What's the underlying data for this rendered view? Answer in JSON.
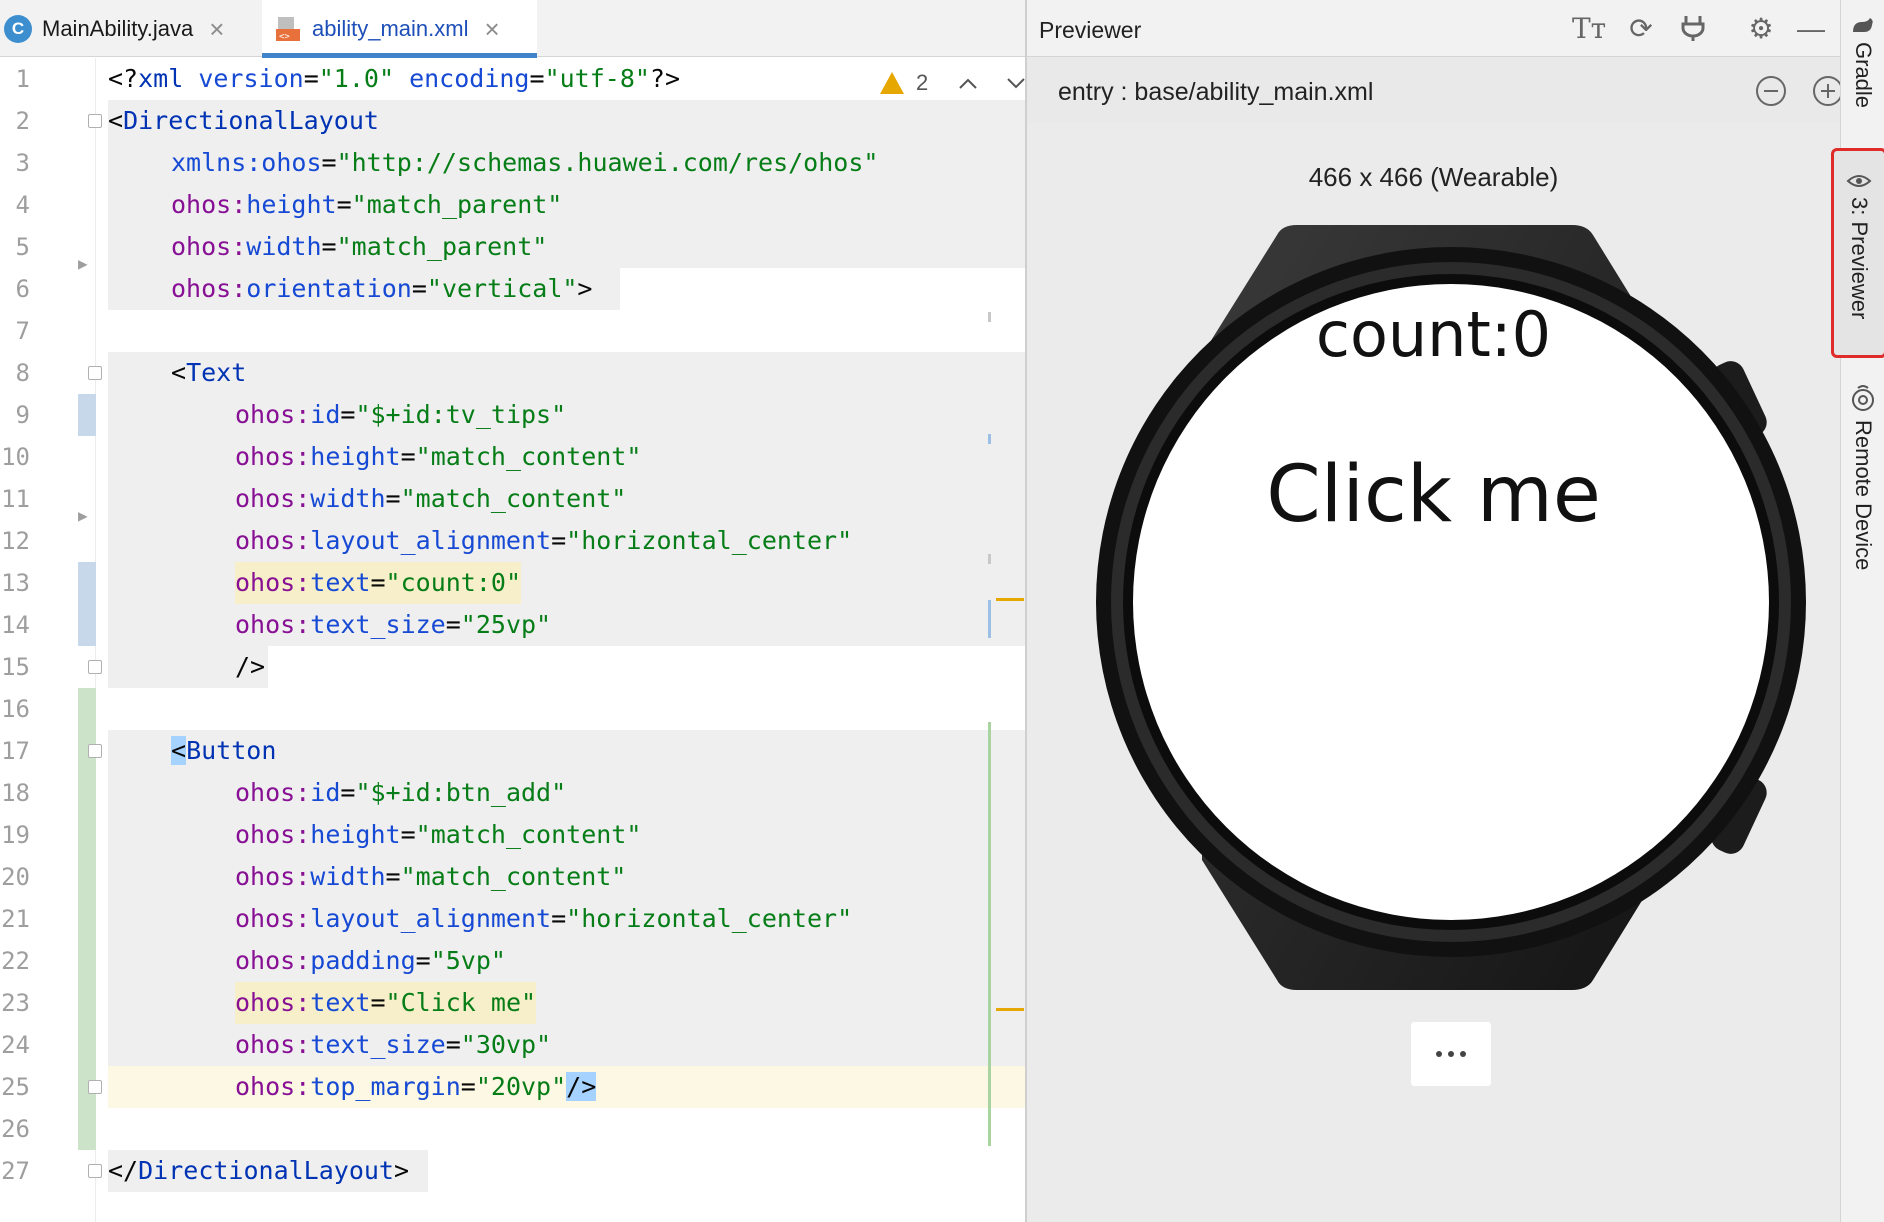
{
  "tabs": [
    {
      "label": "MainAbility.java",
      "icon": "java-class-icon",
      "active": false
    },
    {
      "label": "ability_main.xml",
      "icon": "xml-file-icon",
      "active": true
    }
  ],
  "editor": {
    "warnings_count": "2",
    "line_numbers": [
      "1",
      "2",
      "3",
      "4",
      "5",
      "6",
      "7",
      "8",
      "9",
      "10",
      "11",
      "12",
      "13",
      "14",
      "15",
      "16",
      "17",
      "18",
      "19",
      "20",
      "21",
      "22",
      "23",
      "24",
      "25",
      "26",
      "27"
    ],
    "code": {
      "l1": {
        "open": "<?",
        "xml": "xml",
        "a1": "version",
        "v1": "\"1.0\"",
        "a2": "encoding",
        "v2": "\"utf-8\"",
        "close": "?>"
      },
      "l2": {
        "open": "<",
        "tag": "DirectionalLayout"
      },
      "l3": {
        "ns": "xmlns:ohos",
        "val": "\"http://schemas.huawei.com/res/ohos\""
      },
      "l4": {
        "ns": "ohos:",
        "attr": "height",
        "val": "\"match_parent\""
      },
      "l5": {
        "ns": "ohos:",
        "attr": "width",
        "val": "\"match_parent\""
      },
      "l6": {
        "ns": "ohos:",
        "attr": "orientation",
        "val": "\"vertical\"",
        "close": ">"
      },
      "l8": {
        "open": "<",
        "tag": "Text"
      },
      "l9": {
        "ns": "ohos:",
        "attr": "id",
        "val": "\"$+id:tv_tips\""
      },
      "l10": {
        "ns": "ohos:",
        "attr": "height",
        "val": "\"match_content\""
      },
      "l11": {
        "ns": "ohos:",
        "attr": "width",
        "val": "\"match_content\""
      },
      "l12": {
        "ns": "ohos:",
        "attr": "layout_alignment",
        "val": "\"horizontal_center\""
      },
      "l13": {
        "ns": "ohos:",
        "attr": "text",
        "val": "\"count:0\""
      },
      "l14": {
        "ns": "ohos:",
        "attr": "text_size",
        "val": "\"25vp\""
      },
      "l15": {
        "close": "/>"
      },
      "l17": {
        "open": "<",
        "tag": "Button"
      },
      "l18": {
        "ns": "ohos:",
        "attr": "id",
        "val": "\"$+id:btn_add\""
      },
      "l19": {
        "ns": "ohos:",
        "attr": "height",
        "val": "\"match_content\""
      },
      "l20": {
        "ns": "ohos:",
        "attr": "width",
        "val": "\"match_content\""
      },
      "l21": {
        "ns": "ohos:",
        "attr": "layout_alignment",
        "val": "\"horizontal_center\""
      },
      "l22": {
        "ns": "ohos:",
        "attr": "padding",
        "val": "\"5vp\""
      },
      "l23": {
        "ns": "ohos:",
        "attr": "text",
        "val": "\"Click me\""
      },
      "l24": {
        "ns": "ohos:",
        "attr": "text_size",
        "val": "\"30vp\""
      },
      "l25": {
        "ns": "ohos:",
        "attr": "top_margin",
        "val": "\"20vp\"",
        "close": "/>"
      },
      "l27": {
        "open": "</",
        "tag": "DirectionalLayout",
        "close": ">"
      }
    },
    "eq": "="
  },
  "previewer": {
    "title": "Previewer",
    "entry_path": "entry : base/ability_main.xml",
    "device_label": "466 x 466 (Wearable)",
    "watch_text": "count:0",
    "watch_button": "Click me"
  },
  "side_tabs": {
    "gradle": "Gradle",
    "previewer": "3: Previewer",
    "remote_device": "Remote Device"
  },
  "colors": {
    "active_tab_underline": "#4083c9",
    "warning": "#e6a700",
    "highlight_box": "#e02b2b"
  }
}
